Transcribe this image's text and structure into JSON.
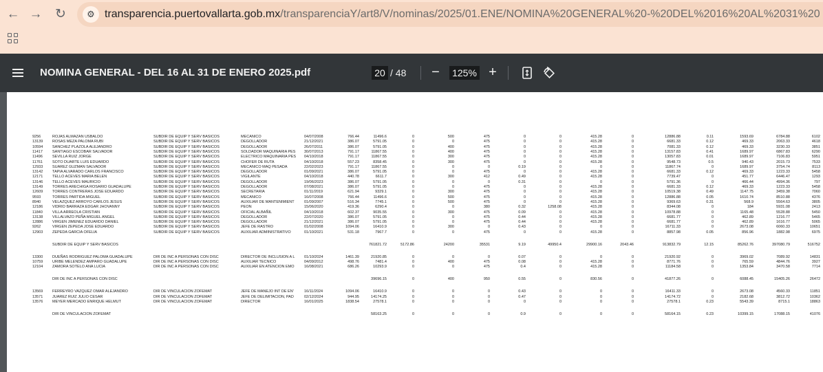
{
  "browser": {
    "url_host": "transparencia.puertovallarta.gob.mx",
    "url_path": "/transparenciaY/art8/V/nominas/2025/01.ENE/NOMINA%20GENERAL%20-%20DEL%2016%20AL%2031%20DE%20ENERO%202025...",
    "icons": [
      "back-arrow-icon",
      "forward-arrow-icon",
      "reload-icon",
      "site-info-icon",
      "apps-grid-icon"
    ]
  },
  "viewer": {
    "title": "NOMINA GENERAL - DEL 16 AL 31 DE ENERO 2025.pdf",
    "current_page": "20",
    "total_pages": "/ 48",
    "zoom": "125%",
    "icons": [
      "menu-icon",
      "zoom-out-icon",
      "zoom-in-icon",
      "fit-page-icon",
      "rotate-icon"
    ]
  },
  "table": {
    "rows": [
      [
        "9256",
        "ROJAS ALMAZAN USBALDO",
        "SUBDIR DE EQUIP Y SERV BASICOS",
        "MECANICO",
        "04/07/2008",
        "766.44",
        "11496.6",
        "0",
        "500",
        "475",
        "0",
        "0",
        "415.28",
        "0",
        "12886.88",
        "0.11",
        "1593.69",
        "6784.88",
        "6102"
      ],
      [
        "13139",
        "ROSAS MEZA PALOMA RUBI",
        "SUBDIR DE EQUIP Y SERV BASICOS",
        "DEGOLLADOR",
        "21/12/2021",
        "386.07",
        "5791.05",
        "0",
        "0",
        "475",
        "0",
        "0",
        "415.28",
        "0",
        "6681.33",
        "0.12",
        "469.33",
        "2063.33",
        "4618"
      ],
      [
        "10594",
        "SANCHEZ PLAZOLA ALEJANDRO",
        "SUBDIR DE EQUIP Y SERV BASICOS",
        "DEGOLLADOR",
        "26/07/2011",
        "386.07",
        "5791.05",
        "0",
        "400",
        "475",
        "0",
        "0",
        "415.28",
        "0",
        "7081.33",
        "0.12",
        "469.33",
        "3230.33",
        "3851"
      ],
      [
        "11417",
        "SANTIAGO ESCOBAR SALVADOR",
        "SUBDIR DE EQUIP Y SERV BASICOS",
        "SOLDADOR MAQUINARIA PES",
        "30/07/2013",
        "791.17",
        "11867.55",
        "0",
        "400",
        "475",
        "0",
        "0",
        "415.28",
        "0",
        "13157.83",
        "0.41",
        "1689.97",
        "6867.83",
        "6290"
      ],
      [
        "11496",
        "SEVILLA RUIZ JORGE",
        "SUBDIR DE EQUIP Y SERV BASICOS",
        "ELECTRICO MAQUINARIA PES",
        "04/10/2018",
        "791.17",
        "11867.55",
        "0",
        "300",
        "475",
        "0",
        "0",
        "415.28",
        "0",
        "13057.83",
        "0.01",
        "1689.97",
        "7106.83",
        "5951"
      ],
      [
        "11761",
        "SOTO DUARTE LUIS EDUARDO",
        "SUBDIR DE EQUIP Y SERV BASICOS",
        "CHOFER DE RUTA",
        "04/10/2018",
        "557.23",
        "8358.45",
        "0",
        "300",
        "475",
        "0",
        "0",
        "415.28",
        "0",
        "9548.73",
        "0.5",
        "940.43",
        "2015.73",
        "7533"
      ],
      [
        "12933",
        "SUAREZ GUZMAN SALVADOR",
        "SUBDIR DE EQUIP Y SERV BASICOS",
        "MECANICO MAQ PESADA",
        "22/02/2023",
        "791.17",
        "11867.55",
        "0",
        "0",
        "0",
        "0.19",
        "0",
        "0",
        "0",
        "11867.74",
        "0",
        "1689.97",
        "3754.74",
        "8113"
      ],
      [
        "13142",
        "TAPIA ALVARADO CARLOS FRANCISCO",
        "SUBDIR DE EQUIP Y SERV BASICOS",
        "DEGOLLADOR",
        "01/09/2021",
        "386.07",
        "5791.05",
        "0",
        "0",
        "475",
        "0",
        "0",
        "415.28",
        "0",
        "6681.33",
        "0.12",
        "469.33",
        "1223.33",
        "5458"
      ],
      [
        "12171",
        "TELLO ACEVES MARIA BELEN",
        "SUBDIR DE EQUIP Y SERV BASICOS",
        "VIGILANTE",
        "04/10/2018",
        "440.78",
        "6611.7",
        "0",
        "300",
        "412",
        "0.49",
        "0",
        "415.28",
        "0",
        "7739.47",
        "0",
        "451.77",
        "6446.47",
        "1293"
      ],
      [
        "13146",
        "TELLO ACEVES MAURICIO",
        "SUBDIR DE EQUIP Y SERV BASICOS",
        "DEGOLLADOR",
        "19/06/2023",
        "386.07",
        "5791.05",
        "0",
        "0",
        "0",
        "0.31",
        "0",
        "0",
        "0",
        "5791.36",
        "0",
        "466.44",
        "4994.36",
        "797"
      ],
      [
        "13149",
        "TORRES ARECHIGA ROSARIO GUADALUPE",
        "SUBDIR DE EQUIP Y SERV BASICOS",
        "DEGOLLADOR",
        "07/08/2021",
        "386.07",
        "5791.05",
        "0",
        "0",
        "475",
        "0",
        "0",
        "415.28",
        "0",
        "6681.33",
        "0.12",
        "469.33",
        "1223.33",
        "5458"
      ],
      [
        "12609",
        "TORRES CONTRERAS JOSE EDUARDO",
        "SUBDIR DE EQUIP Y SERV BASICOS",
        "SECRETARIA",
        "01/11/2019",
        "621.94",
        "9329.1",
        "0",
        "300",
        "475",
        "0",
        "0",
        "415.28",
        "0",
        "10519.38",
        "0.49",
        "1147.75",
        "3459.38",
        "7060"
      ],
      [
        "9593",
        "TORRES PARTIDA MIGUEL",
        "SUBDIR DE EQUIP Y SERV BASICOS",
        "MECANICO",
        "16/07/2008",
        "766.44",
        "11496.6",
        "0",
        "500",
        "475",
        "0",
        "0",
        "415.28",
        "0",
        "12886.88",
        "0.05",
        "1610.74",
        "8510.88",
        "4376"
      ],
      [
        "8940",
        "VELAZQUEZ ARROYO CARLOS JESUS",
        "SUBDIR DE EQUIP Y SERV BASICOS",
        "AUXILIAR DE MANTENIMIENT",
        "01/09/2007",
        "516.34",
        "7745.1",
        "0",
        "500",
        "475",
        "0",
        "0",
        "415.28",
        "0",
        "9369.63",
        "0.31",
        "568.9",
        "5564.63",
        "3805"
      ],
      [
        "12186",
        "VIDRIO BARRAZA EDGAR JHOVANNY",
        "SUBDIR DE EQUIP Y SERV BASICOS",
        "PEON",
        "15/06/2020",
        "419.36",
        "6290.4",
        "0",
        "0",
        "380",
        "0.32",
        "1258.08",
        "415.28",
        "0",
        "8344.08",
        "0",
        "184",
        "5931.08",
        "2413"
      ],
      [
        "11840",
        "VILLA ARREOLA CRISTIAN",
        "SUBDIR DE EQUIP Y SERV BASICOS",
        "OFICIAL ALBAÑIL",
        "04/10/2018",
        "602.37",
        "9035.55",
        "0",
        "300",
        "475",
        "0.09",
        "0",
        "415.28",
        "0",
        "10978.88",
        "0",
        "1165.48",
        "5528.88",
        "5450"
      ],
      [
        "13138",
        "VILLALVAZO PEÑA MIGUEL ANGEL",
        "SUBDIR DE EQUIP Y SERV BASICOS",
        "DEGOLLADOR",
        "22/07/2020",
        "386.07",
        "5791.05",
        "0",
        "0",
        "475",
        "0.44",
        "0",
        "415.28",
        "0",
        "6681.77",
        "0",
        "462.89",
        "1216.77",
        "5465"
      ],
      [
        "12886",
        "VIRGEN JIMENEZ EDUARDO DANIEL",
        "SUBDIR DE EQUIP Y SERV BASICOS",
        "DEGOLLADOR",
        "21/12/2021",
        "386.07",
        "5791.05",
        "0",
        "0",
        "475",
        "0.44",
        "0",
        "415.28",
        "0",
        "6681.77",
        "0",
        "462.89",
        "1616.77",
        "5065"
      ],
      [
        "9262",
        "VIRGEN ZEPEDA JOSE EDUARDO",
        "SUBDIR DE EQUIP Y SERV BASICOS",
        "JEFE DE RASTRO",
        "01/02/2008",
        "1094.06",
        "16410.9",
        "0",
        "300",
        "0",
        "0.43",
        "0",
        "0",
        "0",
        "16711.33",
        "0",
        "2673.08",
        "6060.33",
        "10651"
      ],
      [
        "12903",
        "ZEPEDA GARCIA OFELIA",
        "SUBDIR DE EQUIP Y SERV BASICOS",
        "AUXILIAR ADMINISTRATIVO",
        "01/10/2021",
        "531.18",
        "7967.7",
        "0",
        "0",
        "475",
        "0",
        "0",
        "415.28",
        "0",
        "8857.98",
        "0.05",
        "856.96",
        "1882.98",
        "6975"
      ],
      [
        "",
        "SUBDIR DE EQUIP Y SERV BASICOS",
        "",
        "",
        "",
        "",
        "761821.72",
        "5172.86",
        "24200",
        "35531",
        "9.19",
        "49950.4",
        "29900.16",
        "2043.46",
        "913832.79",
        "12.15",
        "85262.76",
        "397080.79",
        "516752"
      ],
      [
        "13300",
        "DUEÑAS RODRIGUEZ PALOMA GUADALUPE",
        "DIR DE INC A PERSONAS CON DISC",
        "DIRECTOR DE INCLUSION A L",
        "01/10/2024",
        "1461.39",
        "21920.85",
        "0",
        "0",
        "0",
        "0.07",
        "0",
        "0",
        "0",
        "21920.92",
        "0",
        "3969.02",
        "7089.92",
        "14831"
      ],
      [
        "10759",
        "URIBE MELENDEZ AMPARO GUADALUPE",
        "DIR DE INC A PERSONAS CON DISC",
        "AUXILIAR TECNICO",
        "04/09/2012",
        "498.76",
        "7481.4",
        "0",
        "400",
        "475",
        "0.08",
        "0",
        "415.28",
        "0",
        "8771.76",
        "0",
        "765.59",
        "4844.76",
        "3927"
      ],
      [
        "12104",
        "ZAMORA SOTELO ANA LUCIA",
        "DIR DE INC A PERSONAS CON DISC",
        "AUXILIAR EN ATENCION EMO",
        "16/08/2021",
        "686.26",
        "10293.9",
        "0",
        "0",
        "475",
        "0.4",
        "0",
        "415.28",
        "0",
        "11184.58",
        "0",
        "1353.84",
        "3470.58",
        "7714"
      ],
      [
        "",
        "DIR DE INC A PERSONAS CON DISC",
        "",
        "",
        "",
        "",
        "39696.15",
        "0",
        "400",
        "950",
        "0.55",
        "0",
        "830.56",
        "0",
        "41877.26",
        "0",
        "6088.45",
        "15405.26",
        "26472"
      ],
      [
        "13569",
        "FERREYRO VAZQUEZ OMAR ALEJANDRO",
        "DIR DE VINCULACION ZOFEMAT",
        "JEFE DE MANEJO INT DE EN'",
        "16/11/2024",
        "1094.06",
        "16410.9",
        "0",
        "0",
        "0",
        "0.43",
        "0",
        "0",
        "0",
        "16411.33",
        "0",
        "2673.08",
        "4560.33",
        "11851"
      ],
      [
        "13571",
        "JUAREZ RUIZ JULIO CESAR",
        "DIR DE VINCULACION ZOFEMAT",
        "JEFE DE DELIMITACION, PAD",
        "02/12/2024",
        "944.95",
        "14174.25",
        "0",
        "0",
        "0",
        "0.47",
        "0",
        "0",
        "0",
        "14174.72",
        "0",
        "2182.68",
        "3812.72",
        "10362"
      ],
      [
        "13576",
        "MEYER MERCADO ENRIQUE HELMUT",
        "DIR DE VINCULACION ZOFEMAT",
        "DIRECTOR",
        "16/01/2025",
        "1838.54",
        "27578.1",
        "0",
        "0",
        "0",
        "0",
        "0",
        "0",
        "0",
        "27578.1",
        "0.23",
        "5543.39",
        "8715.1",
        "18863"
      ],
      [
        "",
        "DIR DE VINCULACION ZOFEMAT",
        "",
        "",
        "",
        "",
        "58163.25",
        "0",
        "0",
        "0",
        "0.9",
        "0",
        "0",
        "0",
        "58164.15",
        "0.23",
        "10399.15",
        "17088.15",
        "41076"
      ]
    ]
  }
}
